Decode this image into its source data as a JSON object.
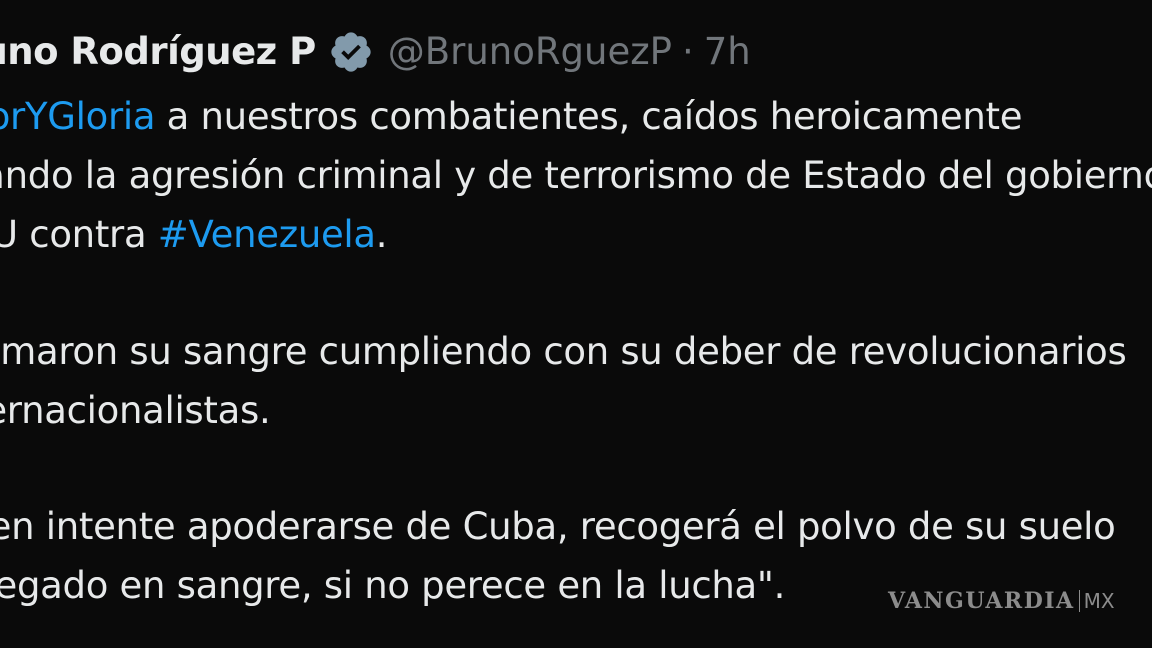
{
  "tweet": {
    "author_name": "Bruno Rodríguez P",
    "handle": "@BrunoRguezP",
    "separator": "·",
    "time": "7h",
    "verified_icon": "verified-badge-icon",
    "lines": [
      {
        "hashtag": "#HonorYGloria",
        "text": " a nuestros combatientes, caídos heroicamente"
      },
      {
        "text": "enfrentando la agresión criminal y de terrorismo de Estado del gobierno"
      },
      {
        "text_before": "de EEUU contra ",
        "hashtag": "#Venezuela",
        "text_after": "."
      },
      {
        "text": "Derramaron su sangre cumpliendo con su deber de revolucionarios"
      },
      {
        "text": "internacionalistas."
      },
      {
        "text": "\"Quien intente apoderarse de Cuba, recogerá el polvo de su suelo"
      },
      {
        "text": "anegado en sangre, si no perece en la lucha\"."
      }
    ]
  },
  "watermark": {
    "brand": "VANGUARDIA",
    "country": "MX"
  },
  "colors": {
    "background": "#0a0a0a",
    "text": "#e7e9ea",
    "muted": "#71767b",
    "hashtag": "#1d9bf0",
    "verified": "#829aab"
  }
}
